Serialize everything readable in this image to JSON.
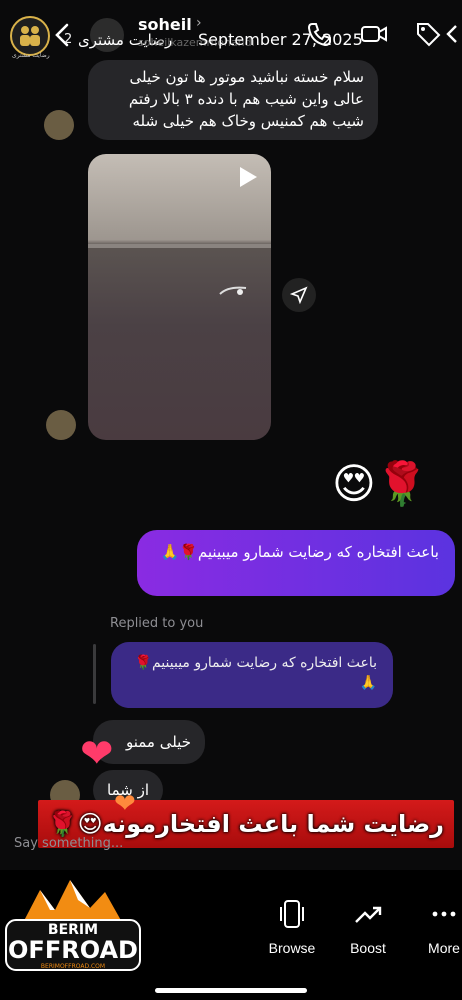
{
  "header": {
    "story_caption": "رضایت مشتری",
    "badge_count": "2",
    "caption_overlay": "رضایت مشتری",
    "contact_name": "soheil",
    "username": "soheilkazemmohandi",
    "date": "September 27, 2025"
  },
  "messages": [
    {
      "text": "سلام خسته نباشید موتور ها تون خیلی عالی واین شیب هم با دنده ۳ بالا رفتم شیب هم کمنیس وخاک هم خیلی شله"
    },
    {
      "reaction": "😍🌹"
    },
    {
      "text": "باعث افتخاره که رضایت شمارو میبینیم🌹🙏"
    },
    {
      "replied_label": "Replied to you"
    },
    {
      "reply_quote": "باعث افتخاره که رضایت شمارو میبینیم🌹🙏"
    },
    {
      "text": "خیلی ممنو"
    },
    {
      "text": "از شما"
    }
  ],
  "banner": {
    "text": "رضایت شما باعث افتخارمونه😍🌹"
  },
  "composer": {
    "placeholder": "Say something..."
  },
  "toolbar": [
    {
      "label": "Browse",
      "icon": "phone-icon"
    },
    {
      "label": "Boost",
      "icon": "trend-up-icon"
    },
    {
      "label": "More",
      "icon": "more-dots-icon"
    }
  ],
  "logo": {
    "line1": "BERIM",
    "line2": "OFFROAD",
    "line3": "BERIMOFFROAD.COM"
  },
  "colors": {
    "outgoing_bubble": "#7b2fe4",
    "incoming_bubble": "#262629",
    "banner": "#c51414"
  }
}
